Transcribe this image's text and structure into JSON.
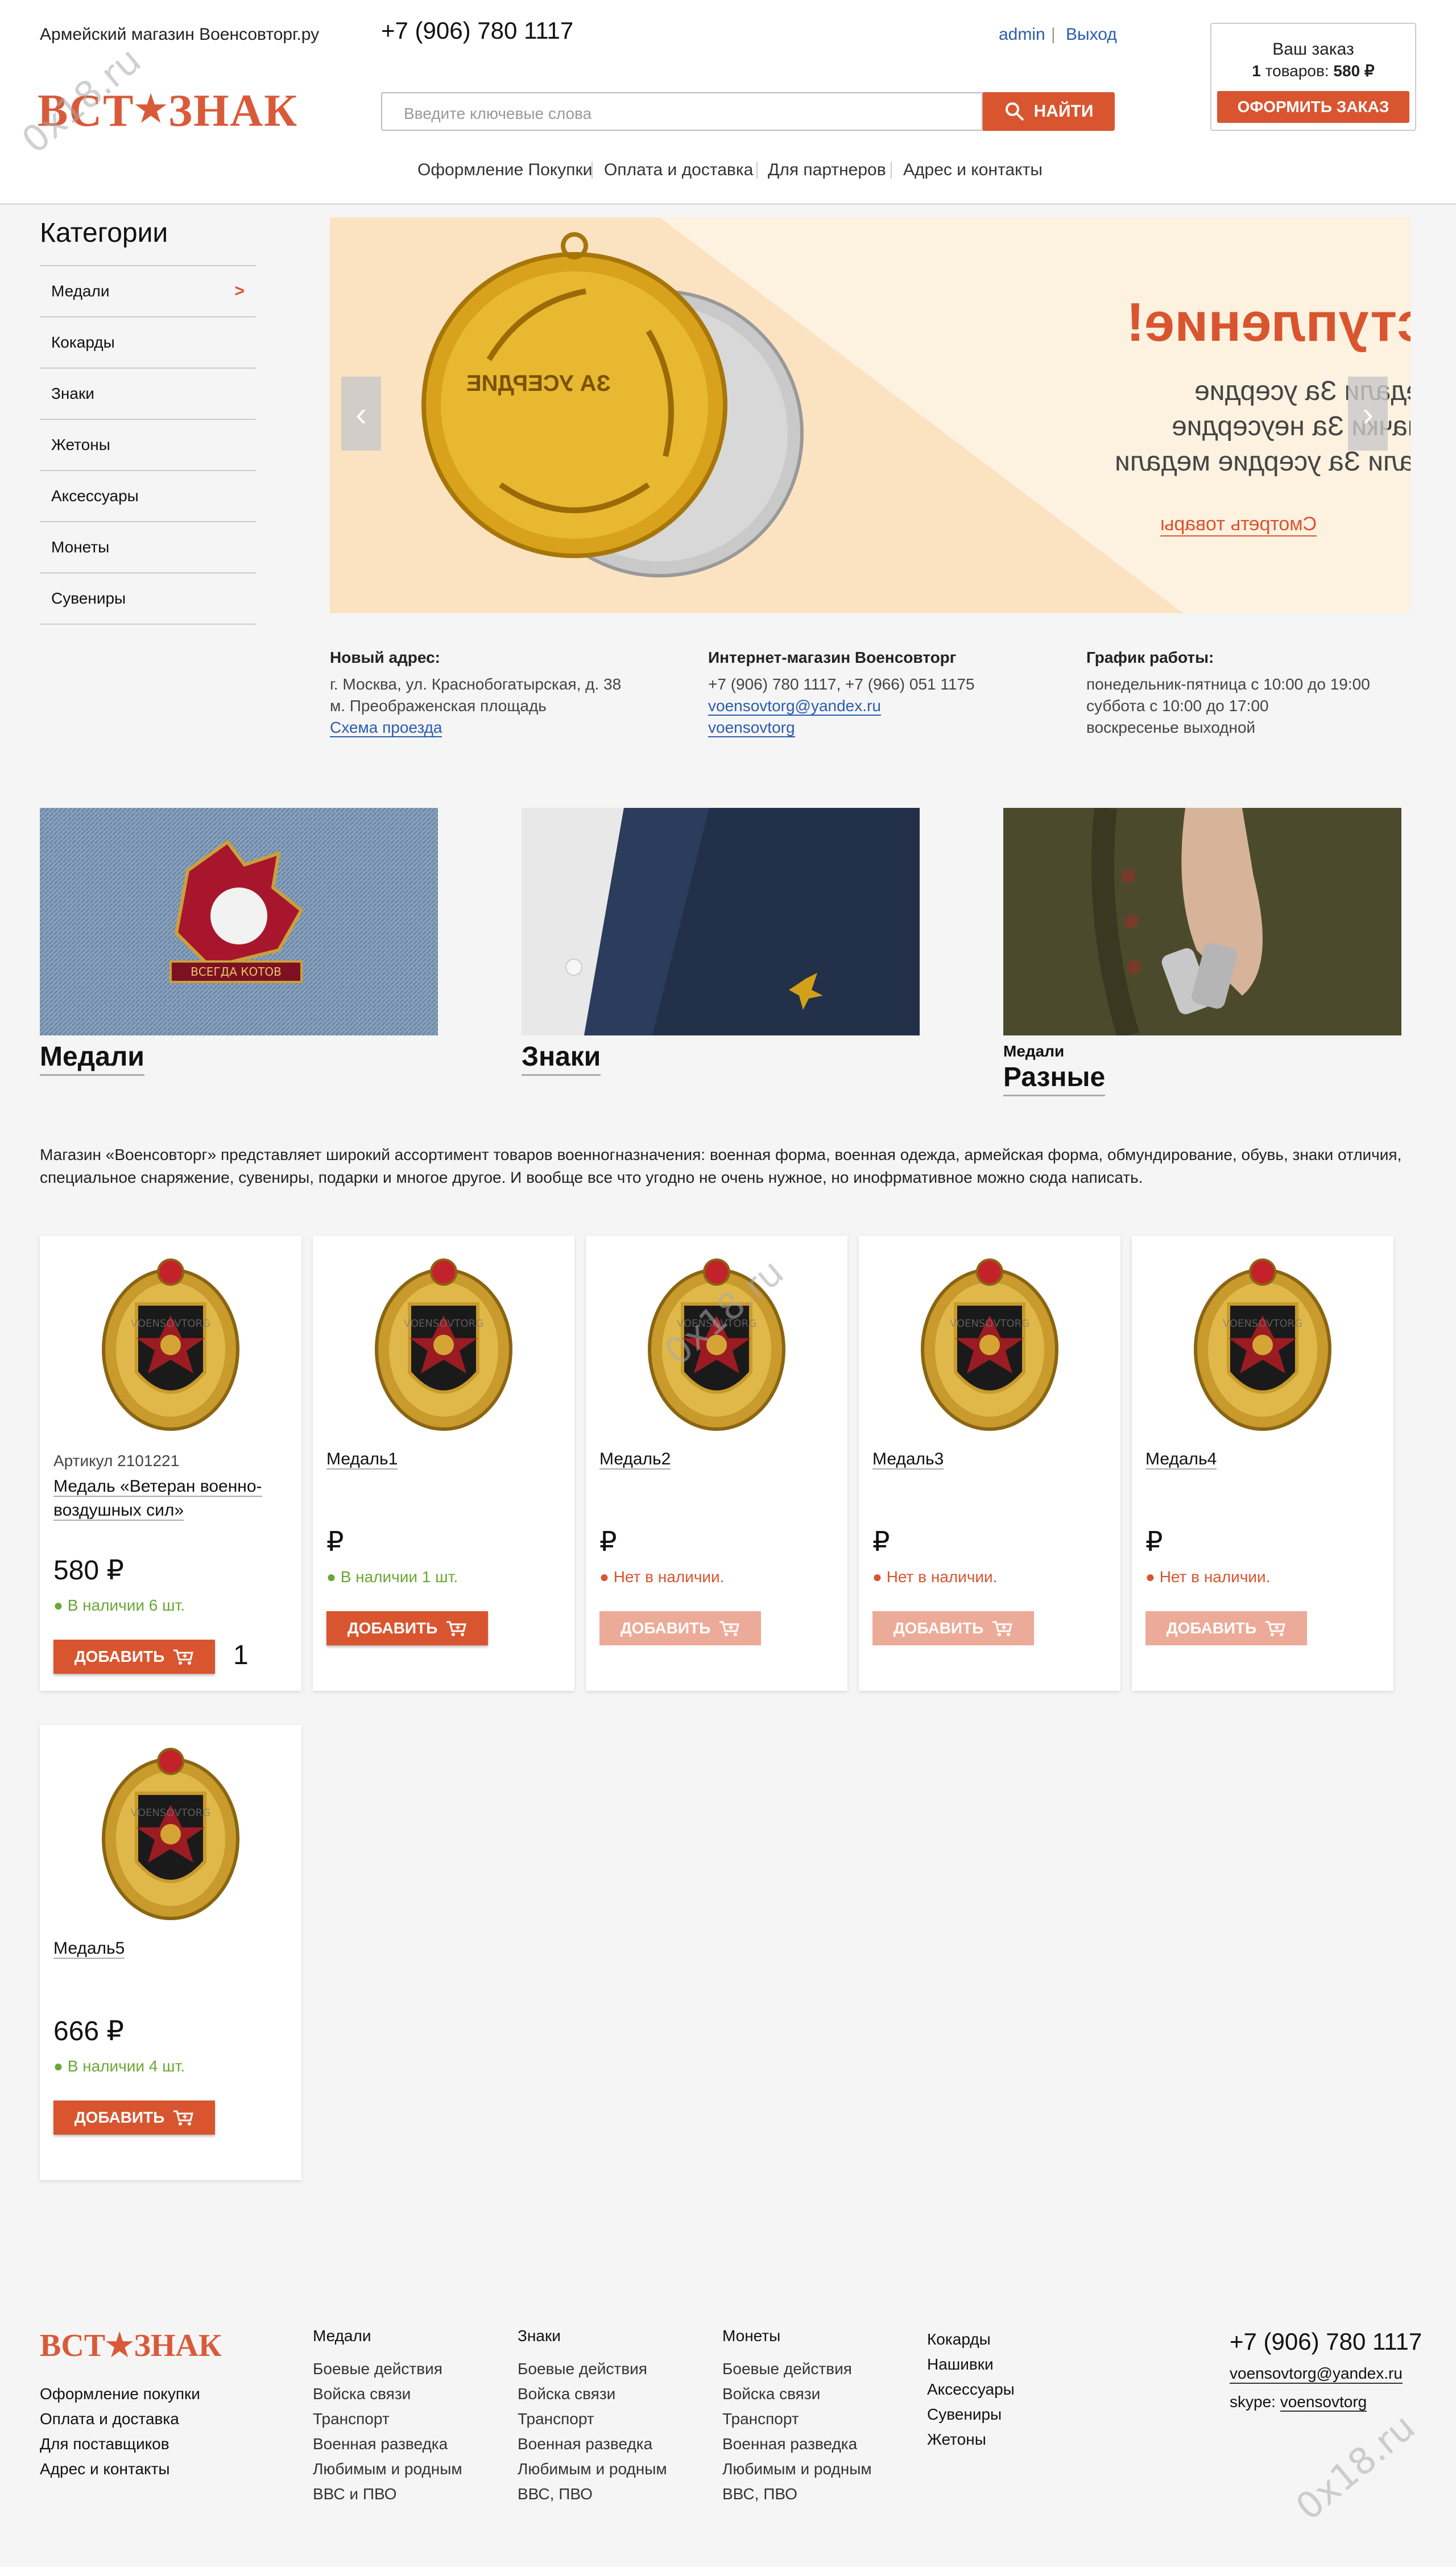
{
  "header": {
    "tagline": "Армейский магазин Военсовторг.ру",
    "phone": "+7 (906) 780 1117",
    "logo_left": "ВСТ",
    "logo_star": "★",
    "logo_right": "ЗНАК",
    "search_placeholder": "Введите ключевые слова",
    "search_button": "НАЙТИ",
    "user": "admin",
    "auth_sep": "|",
    "logout": "Выход",
    "nav": [
      "Оформление Покупки",
      "Оплата и доставка",
      "Для партнеров",
      "Адрес и контакты"
    ],
    "cart": {
      "title": "Ваш заказ",
      "count": "1",
      "count_suffix": " товаров: ",
      "sum": "580 ₽",
      "button": "ОФОРМИТЬ ЗАКАЗ"
    }
  },
  "sidebar": {
    "title": "Категории",
    "items": [
      "Медали",
      "Кокарды",
      "Знаки",
      "Жетоны",
      "Аксессуары",
      "Монеты",
      "Сувениры"
    ],
    "active_marker": ">"
  },
  "banner": {
    "heading": "Новое поступление!",
    "lines": [
      "Медали За усердие",
      "Значки За неусердие",
      "Медали За усердие медали"
    ],
    "link": "Смотреть товары",
    "medal_text": "ЗА УСЕРДИЕ"
  },
  "info": {
    "address": {
      "title": "Новый адрес:",
      "line1": "г. Москва, ул. Краснобогатырская, д. 38",
      "line2": "м. Преображенская площадь",
      "link": "Схема проезда"
    },
    "shop": {
      "title": "Интернет-магазин Военсовторг",
      "phones": "+7 (906) 780 1117, +7 (966) 051 1175",
      "email": "voensovtorg@yandex.ru",
      "skype": "voensovtorg"
    },
    "hours": {
      "title": "График работы:",
      "line1": "понедельник-пятница с 10:00 до 19:00",
      "line2": "суббота с 10:00 до 17:00",
      "line3": "воскресенье выходной"
    }
  },
  "tiles": [
    {
      "label": "Медали",
      "sub": "",
      "pin_text": "ВСЕГДА КОТОВ"
    },
    {
      "label": "Знаки",
      "sub": ""
    },
    {
      "label": "Разные",
      "sub": "Медали"
    }
  ],
  "description": "Магазин «Военсовторг» представляет широкий ассортимент товаров военногназначения: военная форма, военная одежда, армейская форма, обмундирование, обувь, знаки отличия, специальное снаряжение, сувениры, подарки и многое другое. И вообще все что угодно не очень нужное, но инофрмативное можно сюда написать.",
  "products": [
    {
      "sku": "Артикул 2101221",
      "name": "Медаль «Ветеран военно-воздушных сил»",
      "price": "580 ₽",
      "stock": "● В наличии 6 шт.",
      "in_stock": true,
      "button": "ДОБАВИТЬ",
      "qty": "1"
    },
    {
      "sku": "",
      "name": "Медаль1",
      "price": "₽",
      "stock": "● В наличии 1 шт.",
      "in_stock": true,
      "button": "ДОБАВИТЬ",
      "qty": ""
    },
    {
      "sku": "",
      "name": "Медаль2",
      "price": "₽",
      "stock": "● Нет в наличии.",
      "in_stock": false,
      "button": "ДОБАВИТЬ",
      "qty": ""
    },
    {
      "sku": "",
      "name": "Медаль3",
      "price": "₽",
      "stock": "● Нет в наличии.",
      "in_stock": false,
      "button": "ДОБАВИТЬ",
      "qty": ""
    },
    {
      "sku": "",
      "name": "Медаль4",
      "price": "₽",
      "stock": "● Нет в наличии.",
      "in_stock": false,
      "button": "ДОБАВИТЬ",
      "qty": ""
    },
    {
      "sku": "",
      "name": "Медаль5",
      "price": "666 ₽",
      "stock": "● В наличии 4 шт.",
      "in_stock": true,
      "button": "ДОБАВИТЬ",
      "qty": ""
    }
  ],
  "product_image_text": "VOENSOVTORG",
  "footer": {
    "logo": "ВСТ★ЗНАК",
    "links": [
      "Оформление покупки",
      "Оплата и доставка",
      "Для поставщиков",
      "Адрес и контакты"
    ],
    "columns": [
      {
        "title": "Медали",
        "items": [
          "Боевые действия",
          "Войска связи",
          "Транспорт",
          "Военная разведка",
          "Любимым и родным",
          "ВВС и ПВО"
        ]
      },
      {
        "title": "Знаки",
        "items": [
          "Боевые действия",
          "Войска связи",
          "Транспорт",
          "Военная разведка",
          "Любимым и родным",
          "ВВС, ПВО"
        ]
      },
      {
        "title": "Монеты",
        "items": [
          "Боевые действия",
          "Войска связи",
          "Транспорт",
          "Военная разведка",
          "Любимым и родным",
          "ВВС, ПВО"
        ]
      },
      {
        "title": "",
        "items": [
          "Кокарды",
          "Нашивки",
          "Аксессуары",
          "Сувениры",
          "Жетоны"
        ]
      }
    ],
    "phone": "+7 (906) 780 1117",
    "email": "voensovtorg@yandex.ru",
    "skype_label": "skype: ",
    "skype": "voensovtorg"
  },
  "watermark": "0x18.ru",
  "colors": {
    "accent": "#d9552f",
    "link": "#2a5db0",
    "in_stock": "#6aa834",
    "banner_bg": "#fdf1e0"
  }
}
